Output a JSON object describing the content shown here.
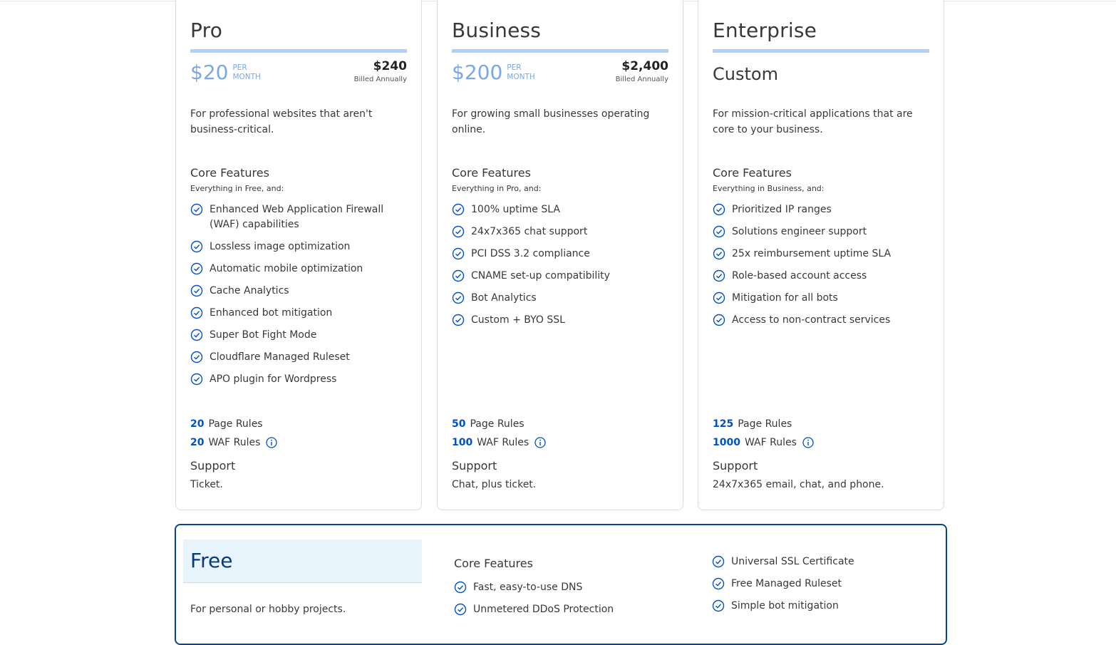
{
  "accent_color": "#0051c3",
  "bar_color": "#aed0fb",
  "plans": [
    {
      "name": "Pro",
      "price": "$20",
      "per": "PER",
      "month": "MONTH",
      "annual_price": "$240",
      "annual_label": "Billed Annually",
      "description": "For professional websites that aren't business-critical.",
      "core_title": "Core Features",
      "core_subtitle": "Everything in Free, and:",
      "features": [
        "Enhanced Web Application Firewall (WAF) capabilities",
        "Lossless image optimization",
        "Automatic mobile optimization",
        "Cache Analytics",
        "Enhanced bot mitigation",
        "Super Bot Fight Mode",
        "Cloudflare Managed Ruleset",
        "APO plugin for Wordpress"
      ],
      "page_rules_count": "20",
      "page_rules_label": "Page Rules",
      "waf_rules_count": "20",
      "waf_rules_label": "WAF Rules",
      "support_title": "Support",
      "support_text": "Ticket."
    },
    {
      "name": "Business",
      "price": "$200",
      "per": "PER",
      "month": "MONTH",
      "annual_price": "$2,400",
      "annual_label": "Billed Annually",
      "description": "For growing small businesses operating online.",
      "core_title": "Core Features",
      "core_subtitle": "Everything in Pro, and:",
      "features": [
        "100% uptime SLA",
        "24x7x365 chat support",
        "PCI DSS 3.2 compliance",
        "CNAME set-up compatibility",
        "Bot Analytics",
        "Custom + BYO SSL"
      ],
      "page_rules_count": "50",
      "page_rules_label": "Page Rules",
      "waf_rules_count": "100",
      "waf_rules_label": "WAF Rules",
      "support_title": "Support",
      "support_text": "Chat, plus ticket."
    },
    {
      "name": "Enterprise",
      "custom_price": "Custom",
      "description": "For mission-critical applications that are core to your business.",
      "core_title": "Core Features",
      "core_subtitle": "Everything in Business, and:",
      "features": [
        "Prioritized IP ranges",
        "Solutions engineer support",
        "25x reimbursement uptime SLA",
        "Role-based account access",
        "Mitigation for all bots",
        "Access to non-contract services"
      ],
      "page_rules_count": "125",
      "page_rules_label": "Page Rules",
      "waf_rules_count": "1000",
      "waf_rules_label": "WAF Rules",
      "support_title": "Support",
      "support_text": "24x7x365 email, chat, and phone."
    }
  ],
  "free": {
    "name": "Free",
    "description": "For personal or hobby projects.",
    "core_title": "Core Features",
    "features_col1": [
      "Fast, easy-to-use DNS",
      "Unmetered DDoS Protection"
    ],
    "features_col2": [
      "Universal SSL Certificate",
      "Free Managed Ruleset",
      "Simple bot mitigation"
    ]
  }
}
